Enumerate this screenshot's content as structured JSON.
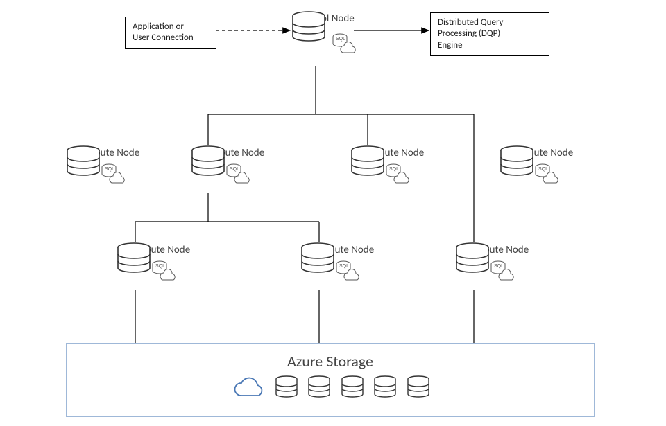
{
  "top": {
    "app_box": "Application or\nUser Connection",
    "dqp_box": "Distributed Query\nProcessing (DQP)\nEngine",
    "control_label": "Control Node"
  },
  "mid": {
    "compute_label": "Compute Node"
  },
  "storage": {
    "title": "Azure Storage"
  },
  "icons": {
    "sql_badge": "SQL"
  }
}
